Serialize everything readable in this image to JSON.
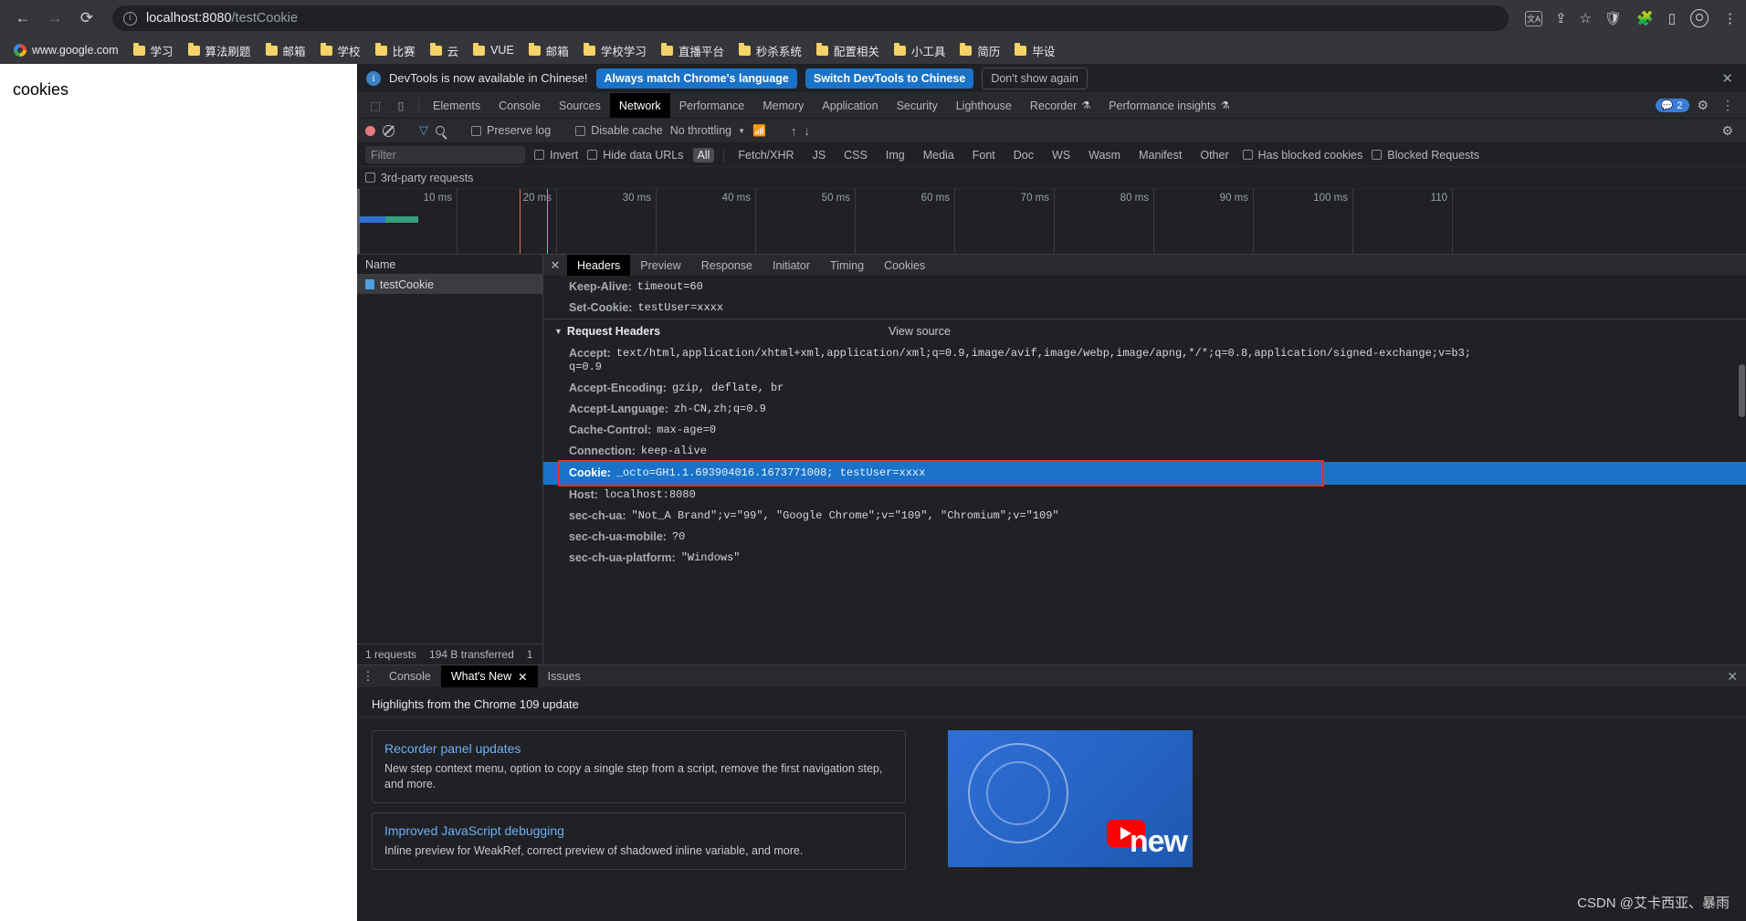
{
  "browser": {
    "nav": {
      "back": "←",
      "forward": "→",
      "reload": "⟳"
    },
    "omnibox": {
      "info_icon": "i",
      "host": "localhost:8080",
      "path": "/testCookie"
    },
    "omnibox_icons": {
      "translate": "文A",
      "share": "share-icon",
      "star": "☆"
    },
    "toolbar_icons": {
      "vpn": "V",
      "extensions": "puzzle-icon",
      "sidepanel": "panel-icon",
      "profile": "avatar-icon",
      "menu": "⋮"
    },
    "bookmarks": [
      {
        "label": "www.google.com",
        "icon": "google-icon"
      },
      {
        "label": "学习",
        "icon": "folder-icon"
      },
      {
        "label": "算法刷题",
        "icon": "folder-icon"
      },
      {
        "label": "邮箱",
        "icon": "folder-icon"
      },
      {
        "label": "学校",
        "icon": "folder-icon"
      },
      {
        "label": "比赛",
        "icon": "folder-icon"
      },
      {
        "label": "云",
        "icon": "folder-icon"
      },
      {
        "label": "VUE",
        "icon": "folder-icon"
      },
      {
        "label": "邮箱",
        "icon": "folder-icon"
      },
      {
        "label": "学校学习",
        "icon": "folder-icon"
      },
      {
        "label": "直播平台",
        "icon": "folder-icon"
      },
      {
        "label": "秒杀系统",
        "icon": "folder-icon"
      },
      {
        "label": "配置相关",
        "icon": "folder-icon"
      },
      {
        "label": "小工具",
        "icon": "folder-icon"
      },
      {
        "label": "简历",
        "icon": "folder-icon"
      },
      {
        "label": "毕设",
        "icon": "folder-icon"
      }
    ]
  },
  "page": {
    "title": "cookies"
  },
  "devtools": {
    "banner": {
      "message": "DevTools is now available in Chinese!",
      "btn_always": "Always match Chrome's language",
      "btn_switch": "Switch DevTools to Chinese",
      "btn_dismiss": "Don't show again",
      "close": "✕"
    },
    "tabs": [
      {
        "label": "Elements",
        "active": false
      },
      {
        "label": "Console",
        "active": false
      },
      {
        "label": "Sources",
        "active": false
      },
      {
        "label": "Network",
        "active": true
      },
      {
        "label": "Performance",
        "active": false
      },
      {
        "label": "Memory",
        "active": false
      },
      {
        "label": "Application",
        "active": false
      },
      {
        "label": "Security",
        "active": false
      },
      {
        "label": "Lighthouse",
        "active": false
      },
      {
        "label": "Recorder",
        "active": false,
        "flask": "⚗"
      },
      {
        "label": "Performance insights",
        "active": false,
        "flask": "⚗"
      }
    ],
    "tabs_right": {
      "message_count": "2",
      "settings": "⚙",
      "more": "⋮"
    },
    "network_toolbar": {
      "record": "record-icon",
      "clear": "clear-icon",
      "filter": "filter-icon",
      "search": "search-icon",
      "preserve_log": "Preserve log",
      "disable_cache": "Disable cache",
      "throttling": "No throttling",
      "caret": "▼",
      "wifi": "wifi-icon",
      "import": "↑",
      "export": "↓",
      "settings": "⚙"
    },
    "filter_bar": {
      "placeholder": "Filter",
      "invert": "Invert",
      "hide_data_urls": "Hide data URLs",
      "resource_types": [
        "All",
        "Fetch/XHR",
        "JS",
        "CSS",
        "Img",
        "Media",
        "Font",
        "Doc",
        "WS",
        "Wasm",
        "Manifest",
        "Other"
      ],
      "active_type": "All",
      "has_blocked_cookies": "Has blocked cookies",
      "blocked_requests": "Blocked Requests",
      "third_party": "3rd-party requests"
    },
    "overview_ticks": [
      "10 ms",
      "20 ms",
      "30 ms",
      "40 ms",
      "50 ms",
      "60 ms",
      "70 ms",
      "80 ms",
      "90 ms",
      "100 ms",
      "110"
    ],
    "request_list": {
      "header": "Name",
      "rows": [
        {
          "name": "testCookie",
          "icon": "document-icon",
          "selected": true
        }
      ],
      "footer": {
        "requests": "1 requests",
        "transferred": "194 B transferred",
        "resources": "1"
      }
    },
    "detail_tabs": [
      {
        "label": "Headers",
        "active": true
      },
      {
        "label": "Preview",
        "active": false
      },
      {
        "label": "Response",
        "active": false
      },
      {
        "label": "Initiator",
        "active": false
      },
      {
        "label": "Timing",
        "active": false
      },
      {
        "label": "Cookies",
        "active": false
      }
    ],
    "detail_close": "✕",
    "response_headers_visible": [
      {
        "key": "Keep-Alive:",
        "value": "timeout=60"
      },
      {
        "key": "Set-Cookie:",
        "value": "testUser=xxxx"
      }
    ],
    "request_headers_section": {
      "triangle": "▼",
      "title": "Request Headers",
      "view_source": "View source"
    },
    "request_headers": [
      {
        "key": "Accept:",
        "value": "text/html,application/xhtml+xml,application/xml;q=0.9,image/avif,image/webp,image/apng,*/*;q=0.8,application/signed-exchange;v=b3;",
        "value2": "q=0.9"
      },
      {
        "key": "Accept-Encoding:",
        "value": "gzip, deflate, br"
      },
      {
        "key": "Accept-Language:",
        "value": "zh-CN,zh;q=0.9"
      },
      {
        "key": "Cache-Control:",
        "value": "max-age=0"
      },
      {
        "key": "Connection:",
        "value": "keep-alive"
      },
      {
        "key": "Cookie:",
        "value": "_octo=GH1.1.693904016.1673771008; testUser=xxxx",
        "highlighted": true
      },
      {
        "key": "Host:",
        "value": "localhost:8080"
      },
      {
        "key": "sec-ch-ua:",
        "value": "\"Not_A Brand\";v=\"99\", \"Google Chrome\";v=\"109\", \"Chromium\";v=\"109\""
      },
      {
        "key": "sec-ch-ua-mobile:",
        "value": "?0"
      },
      {
        "key": "sec-ch-ua-platform:",
        "value": "\"Windows\""
      }
    ],
    "drawer": {
      "more": "⋮",
      "tabs": [
        {
          "label": "Console",
          "active": false,
          "closable": false
        },
        {
          "label": "What's New",
          "active": true,
          "closable": true,
          "close": "✕"
        },
        {
          "label": "Issues",
          "active": false,
          "closable": false
        }
      ],
      "close": "✕",
      "heading": "Highlights from the Chrome 109 update",
      "cards": [
        {
          "title": "Recorder panel updates",
          "desc": "New step context menu, option to copy a single step from a script, remove the first navigation step, and more."
        },
        {
          "title": "Improved JavaScript debugging",
          "desc": "Inline preview for WeakRef, correct preview of shadowed inline variable, and more."
        }
      ],
      "video_text": "new"
    }
  },
  "watermark": "CSDN @艾卡西亚、暴雨",
  "colors": {
    "accent_blue": "#1a73c8",
    "highlight_red": "#ee2b2b",
    "panel_bg": "#202124",
    "toolbar_bg": "#282a2d"
  }
}
